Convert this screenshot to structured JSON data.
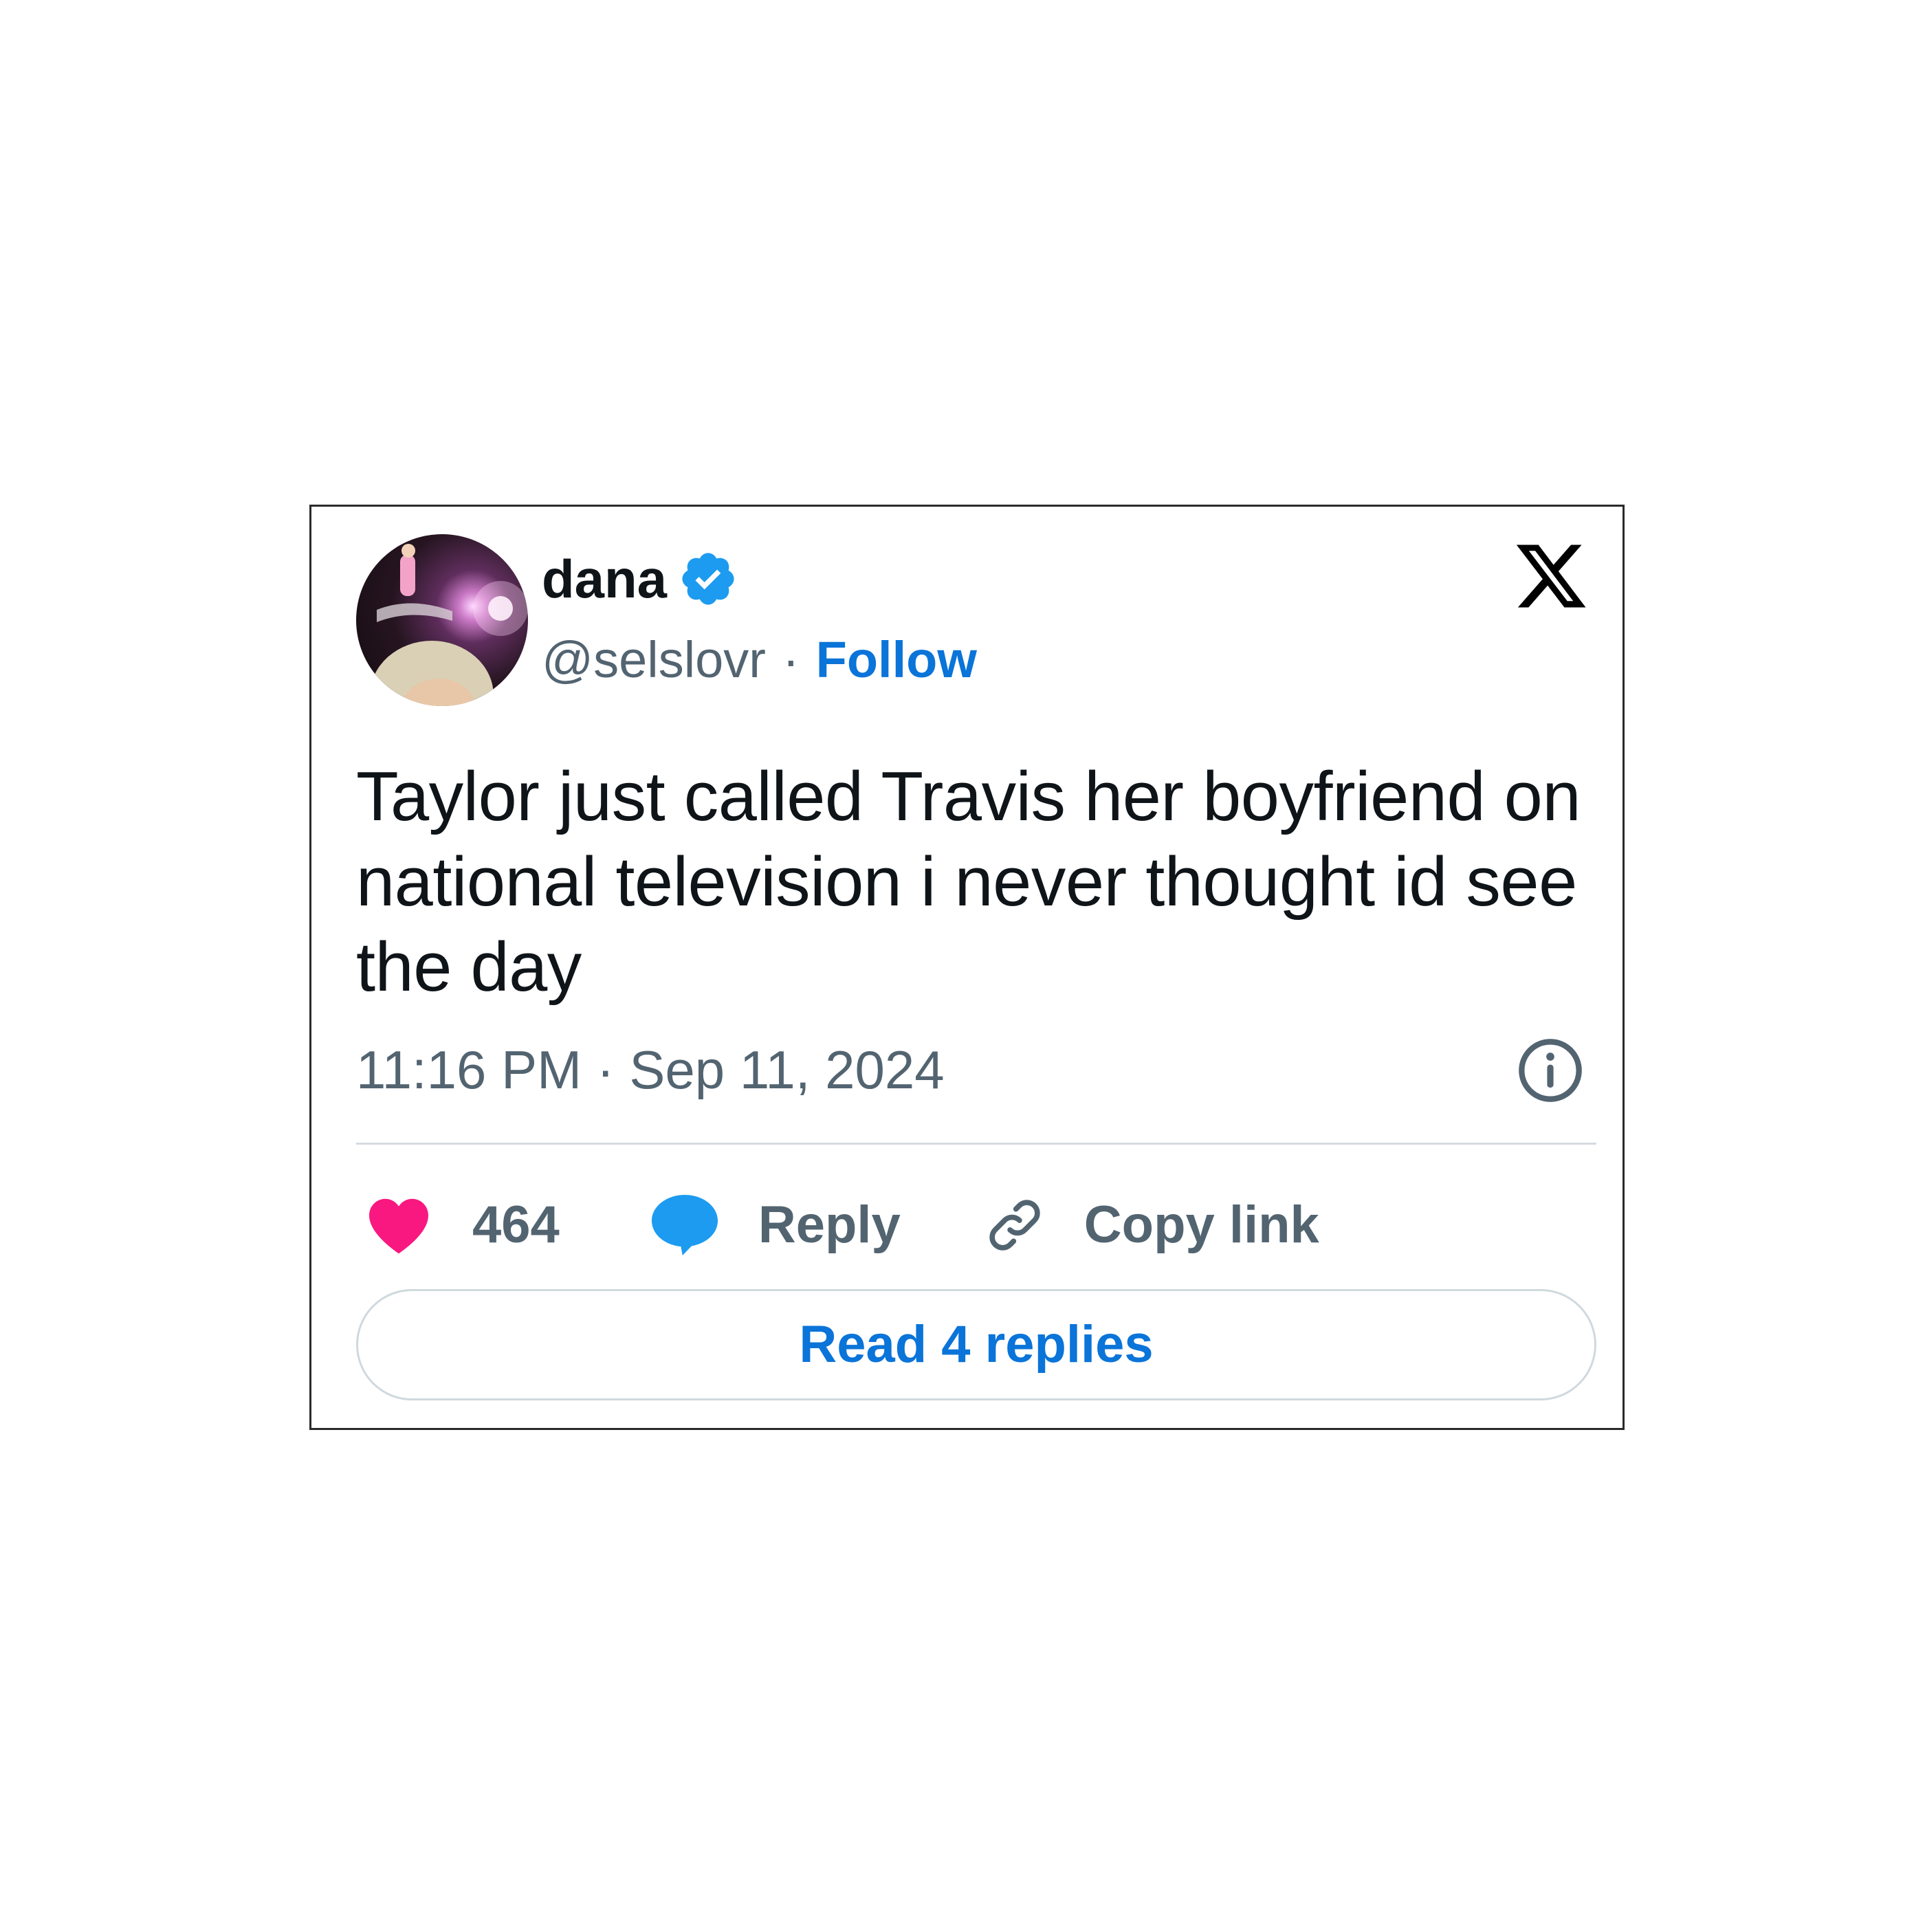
{
  "user": {
    "display_name": "dana",
    "handle": "@selslovr",
    "separator": "·",
    "follow_label": "Follow",
    "verified_icon": "verified-badge-icon",
    "verified_color": "#1d9bf0"
  },
  "brand": {
    "logo_icon": "x-logo-icon"
  },
  "tweet": {
    "text": "Taylor just called Travis her boyfriend on national television i never thought id see the day",
    "timestamp": "11:16 PM · Sep 11, 2024"
  },
  "actions": {
    "like_count": "464",
    "like_color": "#f91880",
    "reply_label": "Reply",
    "reply_color": "#1d9bf0",
    "copy_link_label": "Copy link"
  },
  "footer": {
    "read_replies_label": "Read 4 replies"
  },
  "colors": {
    "link_blue": "#0a74d9",
    "secondary_text": "#536471",
    "primary_text": "#0f1419"
  }
}
